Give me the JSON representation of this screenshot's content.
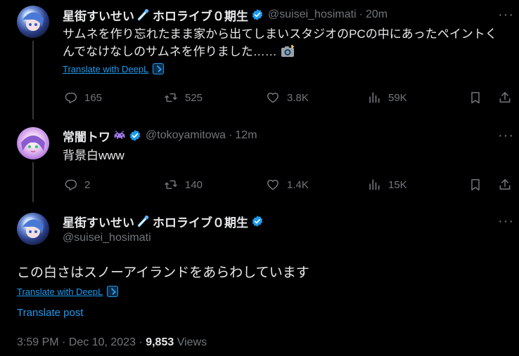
{
  "tweet1": {
    "name": "星街すいせい",
    "name_suffix": "ホロライブ０期生",
    "handle": "@suisei_hosimati",
    "sep": "·",
    "time": "20m",
    "text": "サムネを作り忘れたまま家から出てしまいスタジオのPCの中にあったペイントくんでなけなしのサムネを作りました……",
    "translate": "Translate with DeepL",
    "replies": "165",
    "retweets": "525",
    "likes": "3.8K",
    "views": "59K"
  },
  "tweet2": {
    "name": "常闇トワ",
    "handle": "@tokoyamitowa",
    "sep": "·",
    "time": "12m",
    "text": "背景白www",
    "replies": "2",
    "retweets": "140",
    "likes": "1.4K",
    "views": "15K"
  },
  "tweet3": {
    "name": "星街すいせい",
    "name_suffix": "ホロライブ０期生",
    "handle": "@suisei_hosimati",
    "text": "この白さはスノーアイランドをあらわしています",
    "translate_deepl": "Translate with DeepL",
    "translate_post": "Translate post",
    "timestamp": "3:59 PM · Dec 10, 2023 · ",
    "view_count": "9,853",
    "views_label": "Views"
  },
  "more_glyph": "···",
  "colors": {
    "background": "#000000",
    "text": "#e7e9ea",
    "secondary": "#71767b",
    "link": "#1d9bf0",
    "verified": "#1d9bf0"
  },
  "icons": [
    "reply-icon",
    "retweet-icon",
    "like-icon",
    "views-icon",
    "bookmark-icon",
    "share-icon",
    "verified-icon",
    "meteor-emoji-icon",
    "camera-emoji-icon",
    "space-invader-emoji-icon",
    "more-icon"
  ]
}
